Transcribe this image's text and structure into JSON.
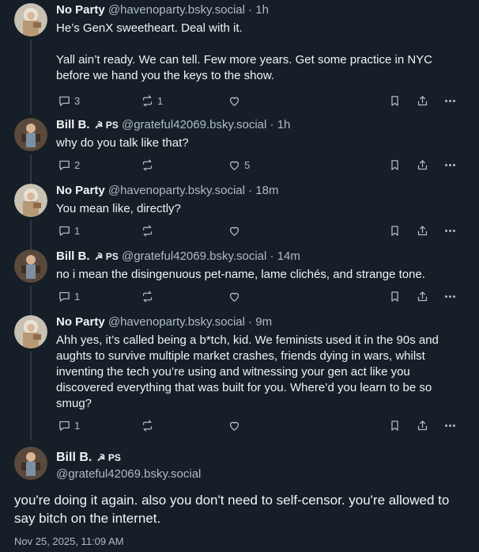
{
  "posts": [
    {
      "name": "No Party",
      "handle": "@havenoparty.bsky.social",
      "time": "1h",
      "badge": "",
      "text": "He’s GenX sweetheart. Deal with it.\n\nYall ain’t ready. We can tell. Few more years. Get some practice in NYC before we hand you the keys to the show.",
      "replies": "3",
      "reposts": "1",
      "likes": ""
    },
    {
      "name": "Bill B.",
      "handle": "@grateful42069.bsky.social",
      "time": "1h",
      "badge": "☭ PS",
      "text": "why do you talk like that?",
      "replies": "2",
      "reposts": "",
      "likes": "5"
    },
    {
      "name": "No Party",
      "handle": "@havenoparty.bsky.social",
      "time": "18m",
      "badge": "",
      "text": "You mean like, directly?",
      "replies": "1",
      "reposts": "",
      "likes": ""
    },
    {
      "name": "Bill B.",
      "handle": "@grateful42069.bsky.social",
      "time": "14m",
      "badge": "☭ PS",
      "text": "no i mean the disingenuous pet-name, lame clichés, and strange tone.",
      "replies": "1",
      "reposts": "",
      "likes": ""
    },
    {
      "name": "No Party",
      "handle": "@havenoparty.bsky.social",
      "time": "9m",
      "badge": "",
      "text": "Ahh yes, it’s called being a b*tch, kid. We feminists used it in the 90s and aughts to survive multiple market crashes, friends dying in wars, whilst inventing the tech you’re using and witnessing your gen act like you discovered everything that was built for you. Where’d you learn to be so smug?",
      "replies": "1",
      "reposts": "",
      "likes": ""
    }
  ],
  "main": {
    "name": "Bill B.",
    "badge": "☭ PS",
    "handle": "@grateful42069.bsky.social",
    "text": "you're doing it again. also you don't need to self-censor. you're allowed to say bitch on the internet.",
    "date": "Nov 25, 2025, 11:09 AM"
  },
  "colors": {
    "background": "#161e27",
    "text": "#f1f3f5",
    "muted": "#aebbc9",
    "thread_line": "#2e3845"
  },
  "icons": [
    "reply-icon",
    "repost-icon",
    "like-icon",
    "bookmark-icon",
    "share-icon",
    "more-icon"
  ]
}
